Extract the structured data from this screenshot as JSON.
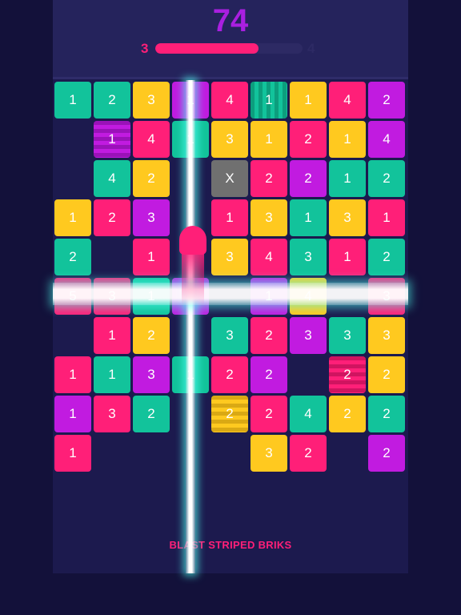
{
  "header": {
    "score": "74",
    "level_current": "3",
    "level_next": "4",
    "level_progress": 0.7
  },
  "colors": {
    "pink": "#ff1f78",
    "teal": "#12c39b",
    "yellow": "#ffc91f",
    "purple": "#c11be0",
    "gray": "#707070"
  },
  "board": {
    "rows": [
      [
        {
          "v": "1",
          "c": "teal"
        },
        {
          "v": "2",
          "c": "teal"
        },
        {
          "v": "3",
          "c": "yellow"
        },
        {
          "v": "1",
          "c": "purple"
        },
        {
          "v": "4",
          "c": "pink"
        },
        {
          "v": "1",
          "c": "teal",
          "s": "v"
        },
        {
          "v": "1",
          "c": "yellow"
        },
        {
          "v": "4",
          "c": "pink"
        },
        {
          "v": "2",
          "c": "purple"
        }
      ],
      [
        null,
        {
          "v": "1",
          "c": "purple",
          "s": "h"
        },
        {
          "v": "4",
          "c": "pink"
        },
        {
          "v": "1",
          "c": "teal"
        },
        {
          "v": "3",
          "c": "yellow"
        },
        {
          "v": "1",
          "c": "yellow"
        },
        {
          "v": "2",
          "c": "pink"
        },
        {
          "v": "1",
          "c": "yellow"
        },
        {
          "v": "4",
          "c": "purple"
        }
      ],
      [
        null,
        {
          "v": "4",
          "c": "teal"
        },
        {
          "v": "2",
          "c": "yellow"
        },
        null,
        {
          "v": "X",
          "c": "gray"
        },
        {
          "v": "2",
          "c": "pink"
        },
        {
          "v": "2",
          "c": "purple"
        },
        {
          "v": "1",
          "c": "teal"
        },
        {
          "v": "2",
          "c": "teal"
        }
      ],
      [
        {
          "v": "1",
          "c": "yellow"
        },
        {
          "v": "2",
          "c": "pink"
        },
        {
          "v": "3",
          "c": "purple"
        },
        null,
        {
          "v": "1",
          "c": "pink"
        },
        {
          "v": "3",
          "c": "yellow"
        },
        {
          "v": "1",
          "c": "teal"
        },
        {
          "v": "3",
          "c": "yellow"
        },
        {
          "v": "1",
          "c": "pink"
        }
      ],
      [
        {
          "v": "2",
          "c": "teal"
        },
        null,
        {
          "v": "1",
          "c": "pink"
        },
        null,
        {
          "v": "3",
          "c": "yellow"
        },
        {
          "v": "4",
          "c": "pink"
        },
        {
          "v": "3",
          "c": "teal"
        },
        {
          "v": "1",
          "c": "pink"
        },
        {
          "v": "2",
          "c": "teal"
        }
      ],
      [
        {
          "v": "5",
          "c": "pink"
        },
        {
          "v": "3",
          "c": "pink"
        },
        {
          "v": "1",
          "c": "teal"
        },
        {
          "v": "",
          "c": "purple"
        },
        null,
        {
          "v": "1",
          "c": "purple"
        },
        {
          "v": "4",
          "c": "yellow"
        },
        null,
        {
          "v": "3",
          "c": "pink"
        }
      ],
      [
        null,
        {
          "v": "1",
          "c": "pink"
        },
        {
          "v": "2",
          "c": "yellow"
        },
        null,
        {
          "v": "3",
          "c": "teal"
        },
        {
          "v": "2",
          "c": "pink"
        },
        {
          "v": "3",
          "c": "purple"
        },
        {
          "v": "3",
          "c": "teal"
        },
        {
          "v": "3",
          "c": "yellow"
        }
      ],
      [
        {
          "v": "1",
          "c": "pink"
        },
        {
          "v": "1",
          "c": "teal"
        },
        {
          "v": "3",
          "c": "purple"
        },
        {
          "v": "1",
          "c": "teal"
        },
        {
          "v": "2",
          "c": "pink"
        },
        {
          "v": "2",
          "c": "purple"
        },
        null,
        {
          "v": "2",
          "c": "pink",
          "s": "h"
        },
        {
          "v": "2",
          "c": "yellow"
        }
      ],
      [
        {
          "v": "1",
          "c": "purple"
        },
        {
          "v": "3",
          "c": "pink"
        },
        {
          "v": "2",
          "c": "teal"
        },
        null,
        {
          "v": "2",
          "c": "yellow",
          "s": "h"
        },
        {
          "v": "2",
          "c": "pink"
        },
        {
          "v": "4",
          "c": "teal"
        },
        {
          "v": "2",
          "c": "yellow"
        },
        {
          "v": "2",
          "c": "teal"
        }
      ],
      [
        {
          "v": "1",
          "c": "pink"
        },
        null,
        null,
        null,
        null,
        {
          "v": "3",
          "c": "yellow"
        },
        {
          "v": "2",
          "c": "pink"
        },
        null,
        {
          "v": "2",
          "c": "purple"
        }
      ]
    ]
  },
  "hint": "BLAST STRIPED BRIKS"
}
